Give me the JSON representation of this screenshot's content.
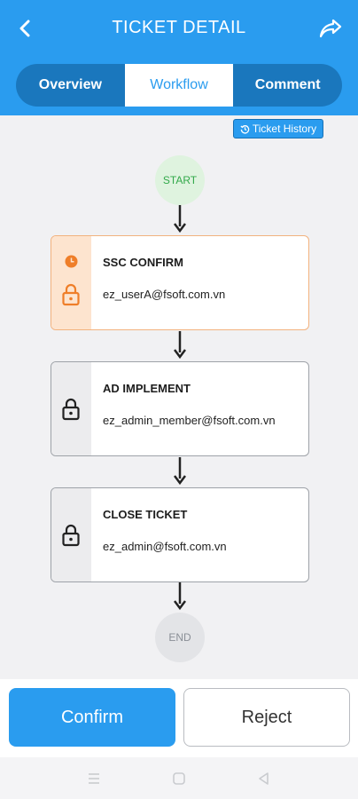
{
  "header": {
    "title": "TICKET DETAIL",
    "back_icon": "chevron-left-icon",
    "share_icon": "share-arrow-icon"
  },
  "tabs": [
    {
      "label": "Overview",
      "active": false
    },
    {
      "label": "Workflow",
      "active": true
    },
    {
      "label": "Comment",
      "active": false
    }
  ],
  "history_button": {
    "label": "Ticket History",
    "icon": "history-icon"
  },
  "workflow": {
    "start_label": "START",
    "end_label": "END",
    "steps": [
      {
        "title": "SSC CONFIRM",
        "assignee": "ez_userA@fsoft.com.vn",
        "status": "current"
      },
      {
        "title": "AD IMPLEMENT",
        "assignee": "ez_admin_member@fsoft.com.vn",
        "status": "locked"
      },
      {
        "title": "CLOSE TICKET",
        "assignee": "ez_admin@fsoft.com.vn",
        "status": "locked"
      }
    ]
  },
  "actions": {
    "confirm_label": "Confirm",
    "reject_label": "Reject"
  },
  "colors": {
    "primary": "#2a9cef",
    "tab_bar": "#1a77bd",
    "current_step": "#f2b27e",
    "current_icon": "#ef7e29",
    "start_node": "#dff3df",
    "start_text": "#32a94a",
    "end_node": "#e3e4e7"
  },
  "nav_bar": {
    "icons": [
      "menu-icon",
      "home-square-icon",
      "back-triangle-icon"
    ]
  }
}
